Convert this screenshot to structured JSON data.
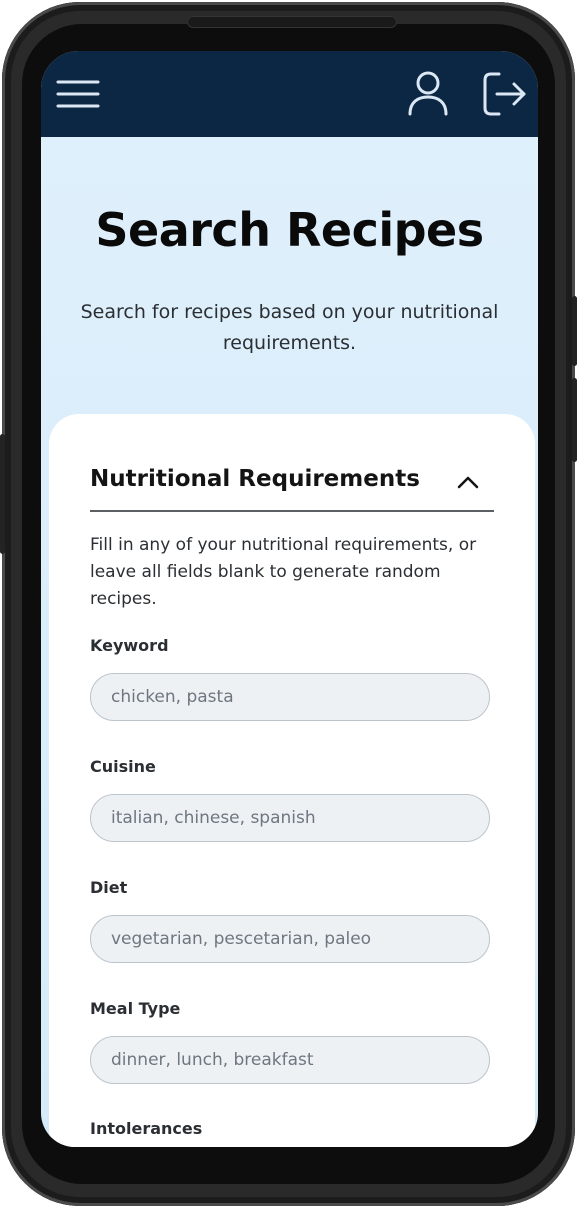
{
  "appbar": {
    "menu_icon": "hamburger-menu-icon",
    "profile_icon": "user-profile-icon",
    "logout_icon": "logout-icon"
  },
  "hero": {
    "title": "Search Recipes",
    "subtitle": "Search for recipes based on your nutritional requirements."
  },
  "section": {
    "title": "Nutritional Requirements",
    "expanded": true,
    "helper_text": "Fill in any of your nutritional requirements, or leave all fields blank to generate random recipes."
  },
  "fields": [
    {
      "label": "Keyword",
      "value": "",
      "placeholder": "chicken, pasta"
    },
    {
      "label": "Cuisine",
      "value": "",
      "placeholder": "italian, chinese, spanish"
    },
    {
      "label": "Diet",
      "value": "",
      "placeholder": "vegetarian, pescetarian, paleo"
    },
    {
      "label": "Meal Type",
      "value": "",
      "placeholder": "dinner, lunch, breakfast"
    },
    {
      "label": "Intolerances"
    }
  ],
  "colors": {
    "appbar": "#0c2744",
    "background": "#dff0fb",
    "card": "#ffffff",
    "input_bg": "#eef1f4",
    "input_border": "#bcc4cc",
    "icon_stroke": "#dbe7f3"
  }
}
